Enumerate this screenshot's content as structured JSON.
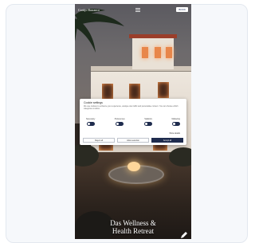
{
  "colors": {
    "accent_navy": "#1f2c4e",
    "warm_light": "#ffa860",
    "frame_bg": "#f6f8fb"
  },
  "site": {
    "logo_text": "Cortijo Barranco",
    "nav_center_icon": "menu-icon",
    "nav_button_label": "BOOK"
  },
  "cookie_modal": {
    "title": "Cookie settings",
    "body": "We use cookies to enhance your experience, analyse site traffic and personalise content. You can choose which categories to allow.",
    "toggles": [
      {
        "label": "Necessary"
      },
      {
        "label": "Preferences"
      },
      {
        "label": "Statistics"
      },
      {
        "label": "Marketing"
      }
    ],
    "details_link": "Show details",
    "buttons": {
      "reject": "Reject all",
      "allow_selection": "Allow selection",
      "accept": "Accept all"
    }
  },
  "hero": {
    "headline_line1": "Das Wellness &",
    "headline_line2": "Health Retreat"
  },
  "icons": {
    "bottom_right": "edit-icon"
  }
}
